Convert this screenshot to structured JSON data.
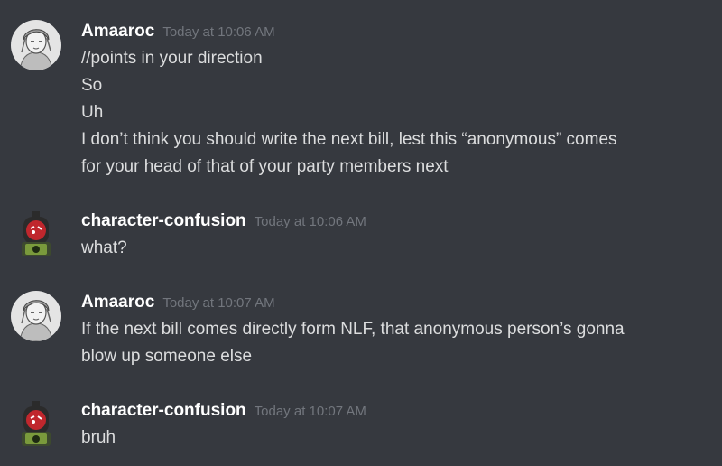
{
  "colors": {
    "background": "#36393f",
    "username": "#ffffff",
    "timestamp": "#72767d",
    "message_text": "#dcddde"
  },
  "messages": [
    {
      "author": "Amaaroc",
      "timestamp": "Today at 10:06 AM",
      "avatar_icon": "sketch-portrait-avatar-icon",
      "lines": [
        "//points in your direction",
        "So",
        "Uh",
        "I don’t think you should write the next bill, lest this “anonymous” comes",
        "for your head of that of your party members next"
      ]
    },
    {
      "author": "character-confusion",
      "timestamp": "Today at 10:06 AM",
      "avatar_icon": "red-robot-avatar-icon",
      "lines": [
        "what?"
      ]
    },
    {
      "author": "Amaaroc",
      "timestamp": "Today at 10:07 AM",
      "avatar_icon": "sketch-portrait-avatar-icon",
      "lines": [
        "If the next bill comes directly form NLF, that anonymous person’s gonna",
        "blow up someone else"
      ]
    },
    {
      "author": "character-confusion",
      "timestamp": "Today at 10:07 AM",
      "avatar_icon": "red-robot-avatar-icon",
      "lines": [
        "bruh"
      ]
    }
  ]
}
